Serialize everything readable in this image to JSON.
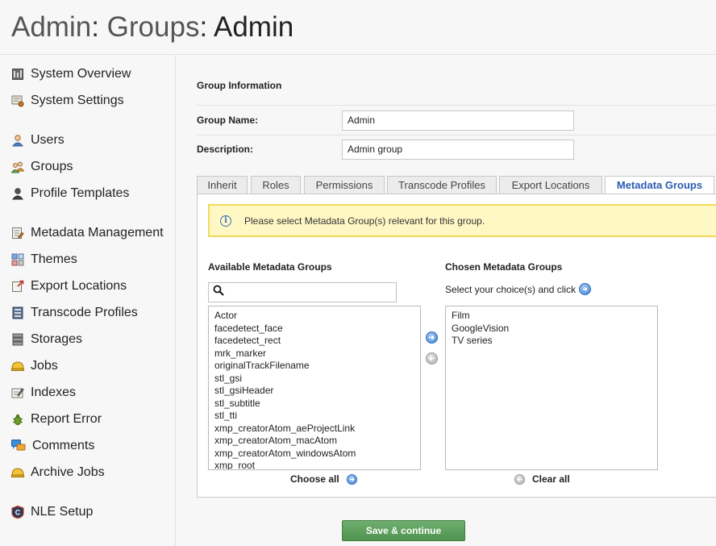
{
  "breadcrumb": {
    "part1": "Admin",
    "sep1": ": ",
    "part2": "Groups",
    "sep2": ": ",
    "current": "Admin"
  },
  "sidebar": {
    "items": [
      {
        "label": "System Overview",
        "icon": "system-overview-icon"
      },
      {
        "label": "System Settings",
        "icon": "system-settings-icon"
      },
      {
        "label": "Users",
        "icon": "users-icon"
      },
      {
        "label": "Groups",
        "icon": "groups-icon"
      },
      {
        "label": "Profile Templates",
        "icon": "profile-templates-icon"
      },
      {
        "label": "Metadata Management",
        "icon": "metadata-management-icon"
      },
      {
        "label": "Themes",
        "icon": "themes-icon"
      },
      {
        "label": "Export Locations",
        "icon": "export-locations-icon"
      },
      {
        "label": "Transcode Profiles",
        "icon": "transcode-profiles-icon"
      },
      {
        "label": "Storages",
        "icon": "storages-icon"
      },
      {
        "label": "Jobs",
        "icon": "jobs-icon"
      },
      {
        "label": "Indexes",
        "icon": "indexes-icon"
      },
      {
        "label": "Report Error",
        "icon": "report-error-icon"
      },
      {
        "label": "Comments",
        "icon": "comments-icon"
      },
      {
        "label": "Archive Jobs",
        "icon": "archive-jobs-icon"
      },
      {
        "label": "NLE Setup",
        "icon": "nle-setup-icon"
      }
    ]
  },
  "form": {
    "section_title": "Group Information",
    "group_name_label": "Group Name:",
    "group_name_value": "Admin",
    "description_label": "Description:",
    "description_value": "Admin group"
  },
  "tabs": [
    {
      "label": "Inherit",
      "active": false
    },
    {
      "label": "Roles",
      "active": false
    },
    {
      "label": "Permissions",
      "active": false
    },
    {
      "label": "Transcode Profiles",
      "active": false
    },
    {
      "label": "Export Locations",
      "active": false
    },
    {
      "label": "Metadata Groups",
      "active": true
    }
  ],
  "metadata_panel": {
    "notice": "Please select Metadata Group(s) relevant for this group.",
    "available_title": "Available Metadata Groups",
    "chosen_title": "Chosen Metadata Groups",
    "chosen_hint": "Select your choice(s) and click",
    "search_value": "",
    "available_items": [
      "Actor",
      "facedetect_face",
      "facedetect_rect",
      "mrk_marker",
      "originalTrackFilename",
      "stl_gsi",
      "stl_gsiHeader",
      "stl_subtitle",
      "stl_tti",
      "xmp_creatorAtom_aeProjectLink",
      "xmp_creatorAtom_macAtom",
      "xmp_creatorAtom_windowsAtom",
      "xmp_root"
    ],
    "chosen_items": [
      "Film",
      "GoogleVision",
      "TV series"
    ],
    "choose_all_label": "Choose all",
    "clear_all_label": "Clear all"
  },
  "actions": {
    "save_label": "Save & continue"
  },
  "colors": {
    "accent_blue": "#2a5db0",
    "save_green": "#5a9e5a",
    "notice_bg": "#fff8c4",
    "notice_border": "#f0d95c"
  }
}
